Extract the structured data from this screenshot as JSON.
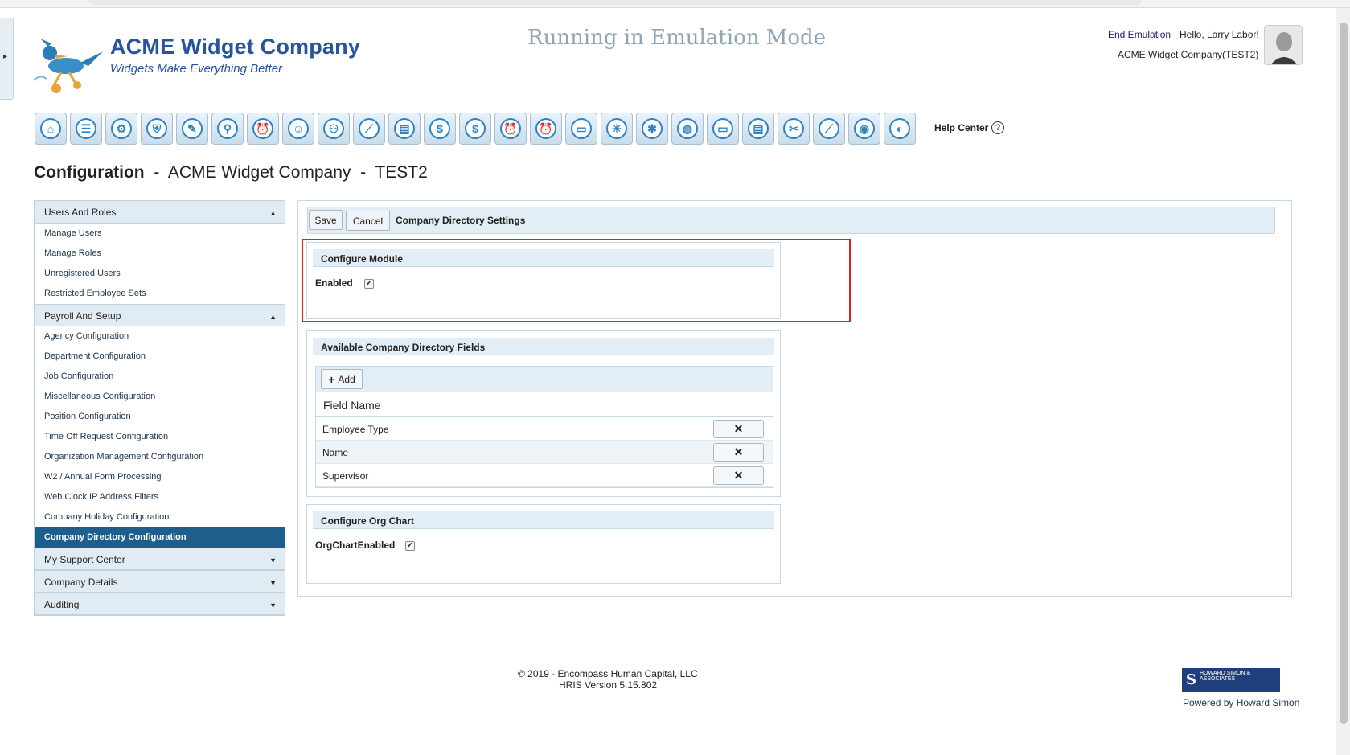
{
  "brand": {
    "title": "ACME Widget Company",
    "tagline": "Widgets Make Everything Better"
  },
  "emulation": {
    "banner": "Running in Emulation Mode",
    "end_link": "End Emulation",
    "greeting": "Hello, Larry Labor!",
    "company": "ACME Widget Company(TEST2)"
  },
  "toolbar": {
    "icons": [
      "home-icon",
      "id-card-icon",
      "gear-group-icon",
      "shield-icon",
      "pen-paper-icon",
      "magnifier-person-icon",
      "alarm-clock-icon",
      "chat-icon",
      "org-chart-icon",
      "line-chart-icon",
      "clipboard-icon",
      "money-chart-icon",
      "dollar-icon",
      "alarm-clock-icon",
      "alarm-clock-icon",
      "folder-icon",
      "lightbulb-icon",
      "asterisk-icon",
      "globe-search-icon",
      "folder-icon",
      "checklist-icon",
      "wrench-pencil-icon",
      "trend-chart-icon",
      "fingerprint-icon",
      "coin-card-icon"
    ],
    "glyphs": [
      "⌂",
      "☰",
      "⚙",
      "⛨",
      "✎",
      "⚲",
      "⏰",
      "☺",
      "⚇",
      "⟋",
      "▤",
      "$",
      "$",
      "⏰",
      "⏰",
      "▭",
      "☀",
      "✱",
      "◍",
      "▭",
      "▤",
      "✂",
      "⟋",
      "◉",
      "◐"
    ],
    "help_label": "Help Center",
    "help_glyph": "?"
  },
  "heading": {
    "section": "Configuration",
    "sep1": " - ",
    "company": "ACME Widget Company",
    "sep2": " - ",
    "env": "TEST2"
  },
  "menu": {
    "users_roles": {
      "label": "Users And Roles",
      "caret": "▲",
      "items": [
        "Manage Users",
        "Manage Roles",
        "Unregistered Users",
        "Restricted Employee Sets"
      ]
    },
    "payroll": {
      "label": "Payroll And Setup",
      "caret": "▲",
      "items": [
        "Agency Configuration",
        "Department Configuration",
        "Job Configuration",
        "Miscellaneous Configuration",
        "Position Configuration",
        "Time Off Request Configuration",
        "Organization Management Configuration",
        "W2 / Annual Form Processing",
        "Web Clock IP Address Filters",
        "Company Holiday Configuration",
        "Company Directory Configuration"
      ]
    },
    "support": {
      "label": "My Support Center",
      "caret": "▼"
    },
    "company_details": {
      "label": "Company Details",
      "caret": "▼"
    },
    "auditing": {
      "label": "Auditing",
      "caret": "▼"
    }
  },
  "main": {
    "save_label": "Save",
    "cancel_label": "Cancel",
    "settings_title": "Company Directory Settings",
    "configure_module": {
      "title": "Configure Module",
      "enabled_label": "Enabled",
      "enabled_check": "✔"
    },
    "fields": {
      "title": "Available Company Directory Fields",
      "add_glyph": "+",
      "add_label": "Add",
      "column": "Field Name",
      "delete_glyph": "✕",
      "rows": [
        "Employee Type",
        "Name",
        "Supervisor"
      ]
    },
    "org_chart": {
      "title": "Configure Org Chart",
      "enabled_label": "OrgChartEnabled",
      "enabled_check": "✔"
    }
  },
  "footer": {
    "copyright": "© 2019 - Encompass Human Capital, LLC",
    "version": "HRIS Version 5.15.802",
    "logo_text": "HOWARD SIMON & ASSOCIATES",
    "logo_letter": "S",
    "powered": "Powered by Howard Simon"
  },
  "sidetab": {
    "glyph": "▸"
  }
}
